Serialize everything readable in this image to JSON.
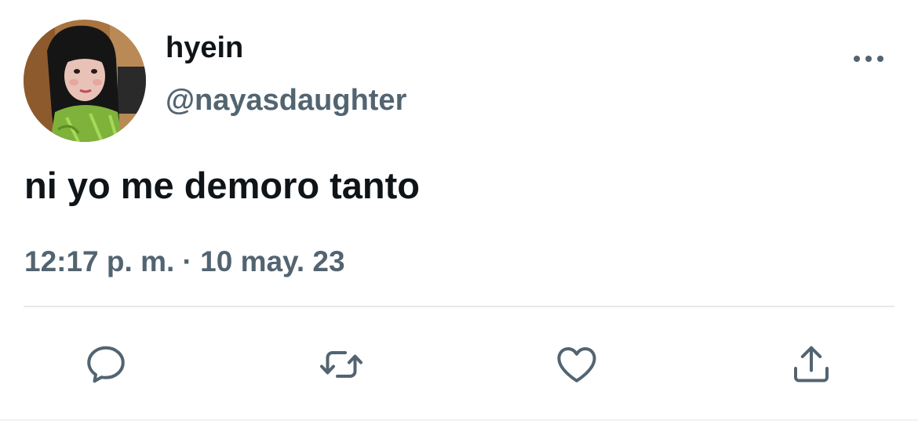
{
  "user": {
    "display_name": "hyein",
    "handle": "@nayasdaughter"
  },
  "tweet": {
    "text": "ni yo me demoro tanto",
    "timestamp": "12:17 p. m. · 10 may. 23"
  },
  "icons": {
    "more": "more-horizontal-icon",
    "reply": "reply-bubble-icon",
    "retweet": "retweet-arrows-icon",
    "like": "heart-icon",
    "share": "share-upload-icon"
  },
  "colors": {
    "text_primary": "#0f1419",
    "text_secondary": "#536471",
    "icon": "#536471",
    "divider": "#e6e9eb"
  }
}
